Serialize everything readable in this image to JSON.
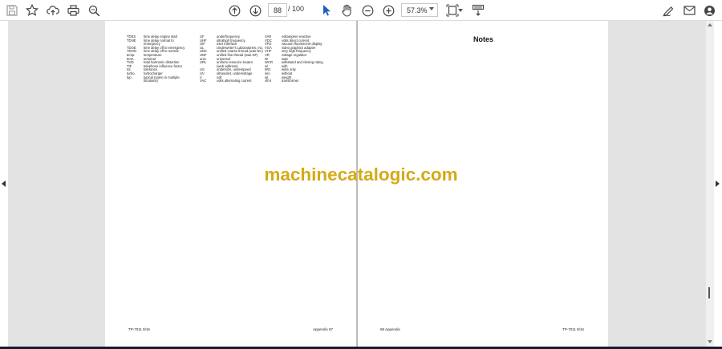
{
  "toolbar": {
    "page_current": "88",
    "page_separator": "/",
    "page_total": "100",
    "zoom": "57.3%"
  },
  "page_left": {
    "abbreviations": [
      [
        [
          "TDES",
          "time delay engine start"
        ],
        [
          "UF",
          "underfrequency"
        ],
        [
          "VAR",
          "voltampere reactive"
        ]
      ],
      [
        [
          "TDNE",
          "time delay normal to"
        ],
        [
          "UHF",
          "ultrahigh frequency"
        ],
        [
          "VDC",
          "volts direct current"
        ]
      ],
      [
        [
          "",
          "emergency"
        ],
        [
          "UIF",
          "user interface"
        ],
        [
          "VFD",
          "vacuum fluorescent display"
        ]
      ],
      [
        [
          "TDOE",
          "time delay off to emergency"
        ],
        [
          "UL",
          "Underwriter's Laboratories, Inc."
        ],
        [
          "VGA",
          "video graphics adapter"
        ]
      ],
      [
        [
          "TDON",
          "time delay off to normal"
        ],
        [
          "UNC",
          "unified coarse thread (was NC)"
        ],
        [
          "VHF",
          "very high frequency"
        ]
      ],
      [
        [
          "temp.",
          "temperature"
        ],
        [
          "UNF",
          "unified fine thread (was NF)"
        ],
        [
          "VR",
          "voltage regulator"
        ]
      ],
      [
        [
          "term.",
          "terminal"
        ],
        [
          "univ.",
          "universal"
        ],
        [
          "W",
          "watt"
        ]
      ],
      [
        [
          "THD",
          "total harmonic distortion"
        ],
        [
          "URL",
          "uniform resource locator"
        ],
        [
          "WCR",
          "withstand and closing rating"
        ]
      ],
      [
        [
          "TIF",
          "telephone influence factor"
        ],
        [
          "",
          "(web address)"
        ],
        [
          "w/",
          "with"
        ]
      ],
      [
        [
          "tol.",
          "tolerance"
        ],
        [
          "US",
          "undersize, underspeed"
        ],
        [
          "WO",
          "write only"
        ]
      ],
      [
        [
          "turbo.",
          "turbocharger"
        ],
        [
          "UV",
          "ultraviolet, undervoltage"
        ],
        [
          "w/o",
          "without"
        ]
      ],
      [
        [
          "typ.",
          "typical (same in multiple"
        ],
        [
          "V",
          "volt"
        ],
        [
          "wt.",
          "weight"
        ]
      ],
      [
        [
          "",
          "locations)"
        ],
        [
          "VAC",
          "volts alternating current"
        ],
        [
          "xfmr",
          "transformer"
        ]
      ]
    ],
    "footer_left": "TP-7011  8/16",
    "footer_right": "Appendix  87"
  },
  "page_right": {
    "heading": "Notes",
    "footer_left": "88  Appendix",
    "footer_right": "TP-7011  8/16"
  },
  "watermark": "machinecatalogic.com",
  "icons": [
    "save-icon",
    "bookmark-star-icon",
    "upload-cloud-icon",
    "print-icon",
    "zoom-search-icon",
    "page-up-icon",
    "page-down-icon",
    "select-cursor-icon",
    "hand-tool-icon",
    "zoom-out-icon",
    "zoom-in-icon",
    "fit-page-icon",
    "scroll-mode-icon",
    "sign-icon",
    "email-icon",
    "account-icon"
  ]
}
